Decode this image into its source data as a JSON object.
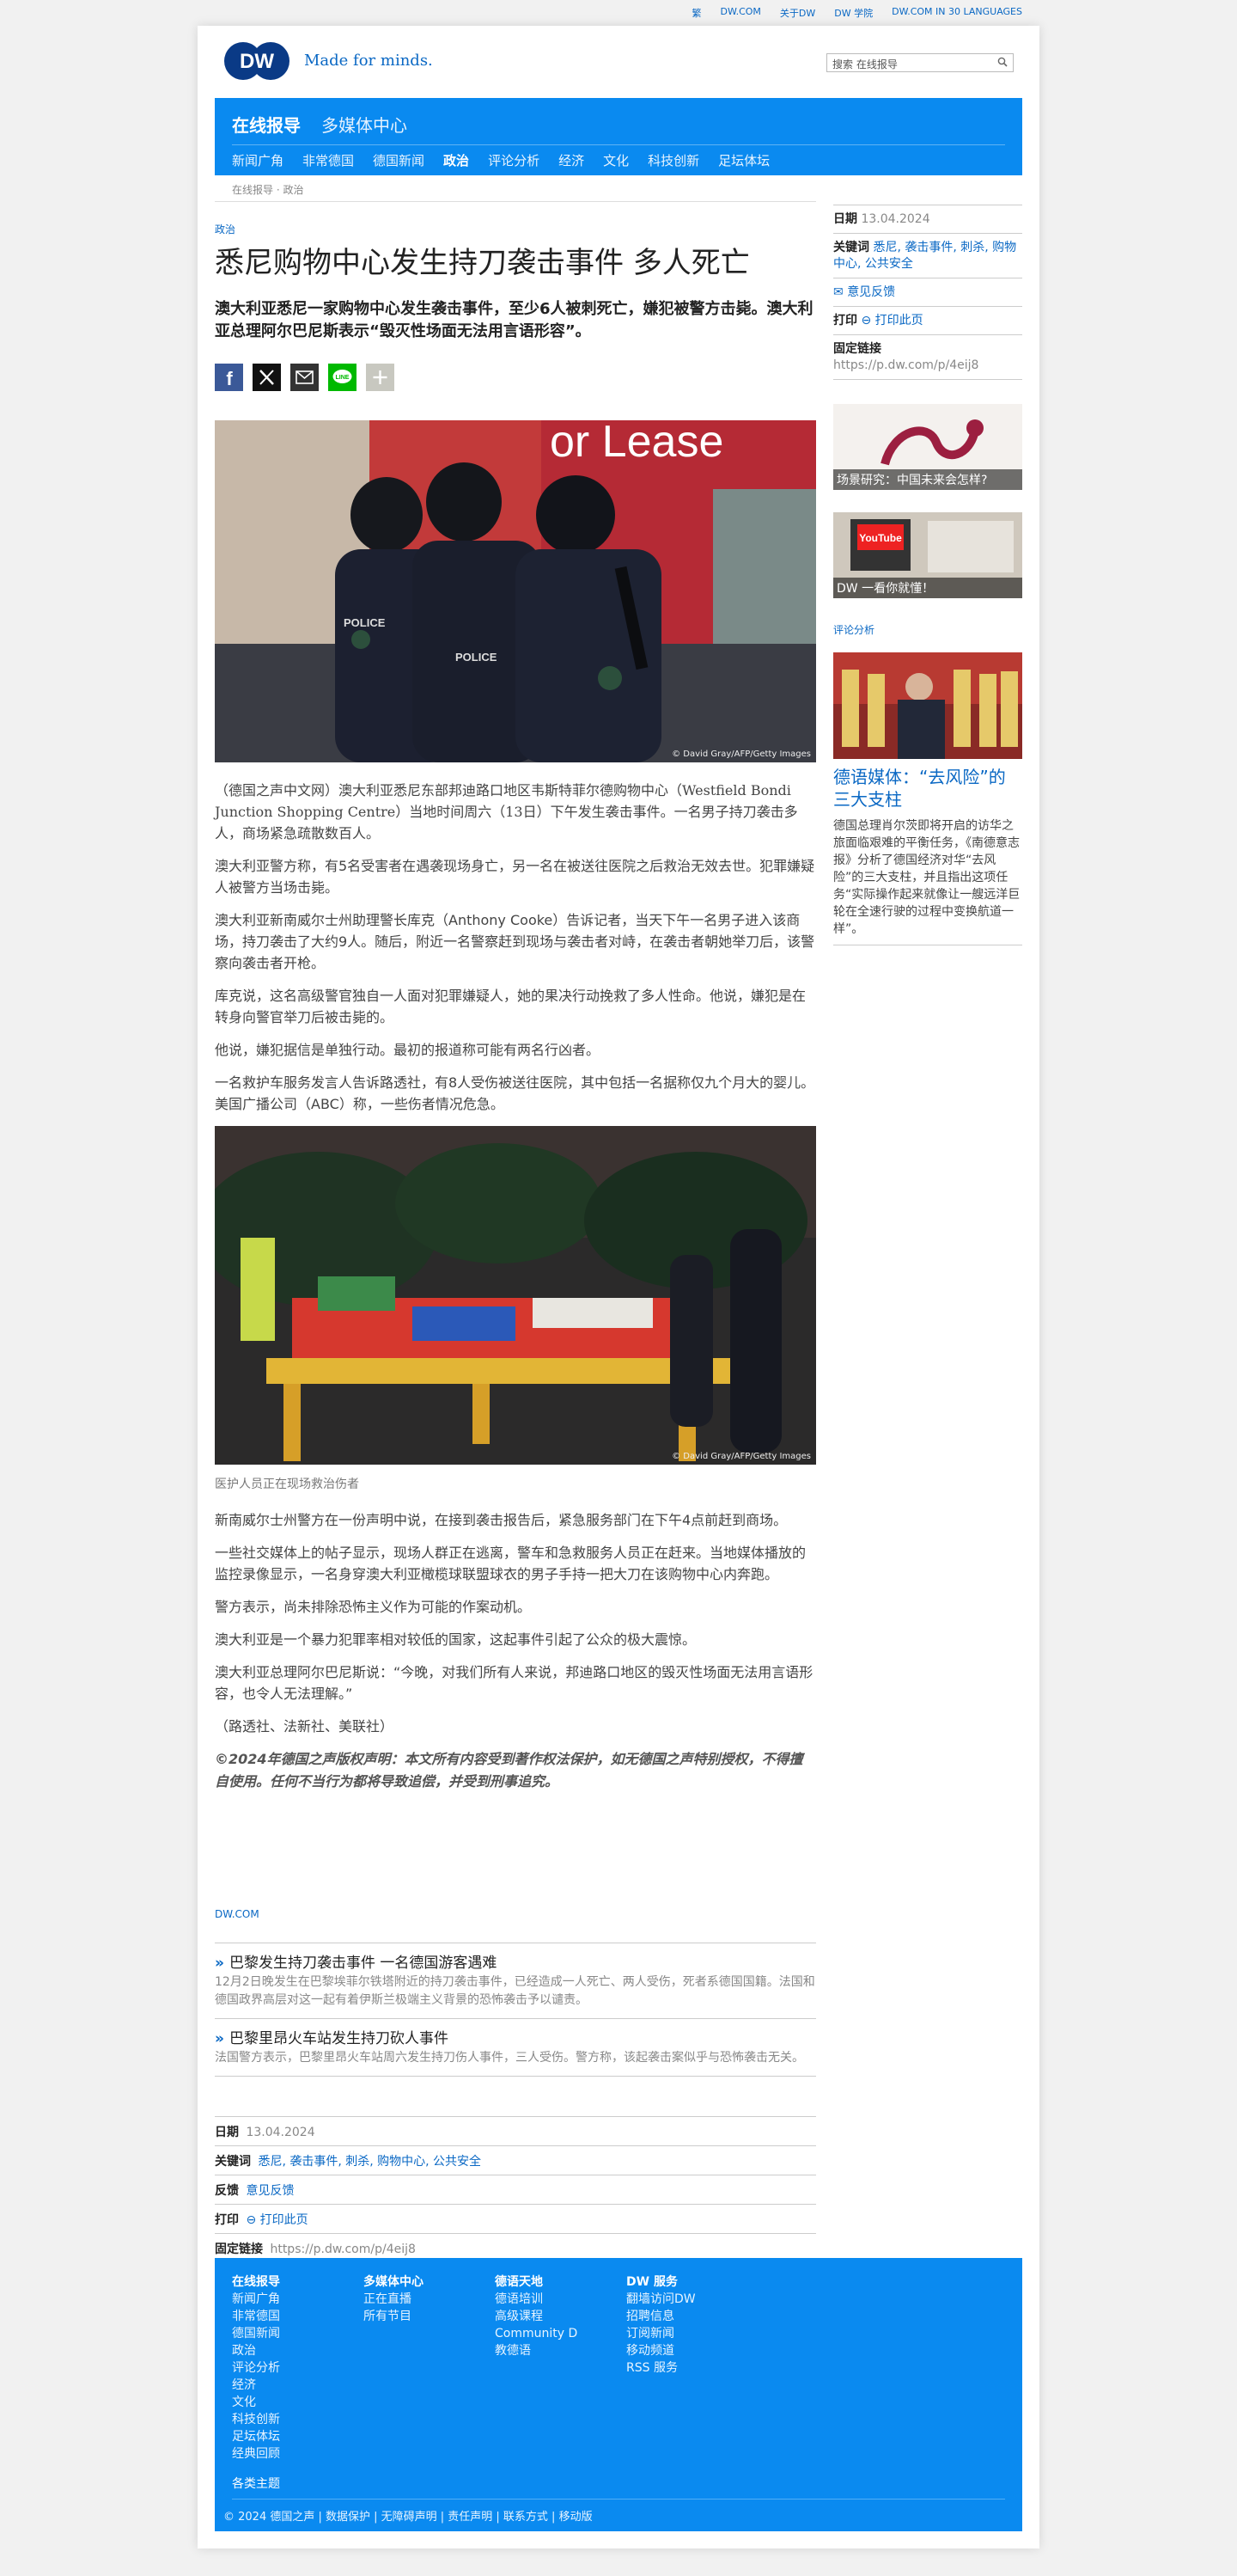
{
  "topbar": {
    "links": [
      "繁",
      "DW.COM",
      "关于DW",
      "DW 学院",
      "DW.COM IN 30 LANGUAGES"
    ]
  },
  "header": {
    "logo_text": "DW",
    "slogan": "Made for minds.",
    "search_placeholder": "搜索 在线报导"
  },
  "nav": {
    "section": "在线报导",
    "media": "多媒体中心",
    "items": [
      "新闻广角",
      "非常德国",
      "德国新闻",
      "政治",
      "评论分析",
      "经济",
      "文化",
      "科技创新",
      "足坛体坛"
    ],
    "active": "政治"
  },
  "breadcrumb": "在线报导 · 政治",
  "article": {
    "kicker": "政治",
    "headline": "悉尼购物中心发生持刀袭击事件 多人死亡",
    "lead": "澳大利亚悉尼一家购物中心发生袭击事件，至少6人被刺死亡，嫌犯被警方击毙。澳大利亚总理阿尔巴尼斯表示“毁灭性场面无法用言语形容”。",
    "share_icons": [
      "facebook-icon",
      "x-icon",
      "email-icon",
      "line-icon",
      "more-icon"
    ],
    "photo1_credit": "© David Gray/AFP/Getty Images",
    "paragraphs1": [
      "（德国之声中文网）澳大利亚悉尼东部邦迪路口地区韦斯特菲尔德购物中心（Westfield Bondi Junction Shopping Centre）当地时间周六（13日）下午发生袭击事件。一名男子持刀袭击多人，商场紧急疏散数百人。",
      "澳大利亚警方称，有5名受害者在遇袭现场身亡，另一名在被送往医院之后救治无效去世。犯罪嫌疑人被警方当场击毙。",
      "澳大利亚新南威尔士州助理警长库克（Anthony Cooke）告诉记者，当天下午一名男子进入该商场，持刀袭击了大约9人。随后，附近一名警察赶到现场与袭击者对峙，在袭击者朝她举刀后，该警察向袭击者开枪。",
      "库克说，这名高级警官独自一人面对犯罪嫌疑人，她的果决行动挽救了多人性命。他说，嫌犯是在转身向警官举刀后被击毙的。",
      "他说，嫌犯据信是单独行动。最初的报道称可能有两名行凶者。",
      "一名救护车服务发言人告诉路透社，有8人受伤被送往医院，其中包括一名据称仅九个月大的婴儿。美国广播公司（ABC）称，一些伤者情况危急。"
    ],
    "photo2_credit": "© David Gray/AFP/Getty Images",
    "photo2_caption": "医护人员正在现场救治伤者",
    "paragraphs2": [
      "新南威尔士州警方在一份声明中说，在接到袭击报告后，紧急服务部门在下午4点前赶到商场。",
      "一些社交媒体上的帖子显示，现场人群正在逃离，警车和急救服务人员正在赶来。当地媒体播放的监控录像显示，一名身穿澳大利亚橄榄球联盟球衣的男子手持一把大刀在该购物中心内奔跑。",
      "警方表示，尚未排除恐怖主义作为可能的作案动机。",
      "澳大利亚是一个暴力犯罪率相对较低的国家，这起事件引起了公众的极大震惊。",
      "澳大利亚总理阿尔巴尼斯说：“今晚，对我们所有人来说，邦迪路口地区的毁灭性场面无法用言语形容，也令人无法理解。”",
      "（路透社、法新社、美联社）"
    ],
    "copyright": "©2024年德国之声版权声明：本文所有内容受到著作权法保护，如无德国之声特别授权，不得擅自使用。任何不当行为都将导致追偿，并受到刑事追究。"
  },
  "related": {
    "label": "DW.COM",
    "items": [
      {
        "title": "巴黎发生持刀袭击事件 一名德国游客遇难",
        "desc": "12月2日晚发生在巴黎埃菲尔铁塔附近的持刀袭击事件，已经造成一人死亡、两人受伤，死者系德国国籍。法国和德国政界高层对这一起有着伊斯兰极端主义背景的恐怖袭击予以谴责。"
      },
      {
        "title": "巴黎里昂火车站发生持刀砍人事件",
        "desc": "法国警方表示，巴黎里昂火车站周六发生持刀伤人事件，三人受伤。警方称，该起袭击案似乎与恐怖袭击无关。"
      }
    ]
  },
  "meta": {
    "date_label": "日期",
    "date": "13.04.2024",
    "keywords_label": "关键词",
    "keywords": "悉尼, 袭击事件, 刺杀, 购物中心, 公共安全",
    "feedback_label": "反馈",
    "feedback": "意见反馈",
    "print_label": "打印",
    "print": "打印此页",
    "permalink_label": "固定链接",
    "permalink": "https://p.dw.com/p/4eij8"
  },
  "sidebar": {
    "feedback_link": "意见反馈",
    "promos": [
      "场景研究：中国未来会怎样?",
      "DW 一看你就懂！"
    ],
    "opinion_kicker": "评论分析",
    "opinion_title": "德语媒体：“去风险”的三大支柱",
    "opinion_desc": "德国总理肖尔茨即将开启的访华之旅面临艰难的平衡任务，《南德意志报》分析了德国经济对华“去风险”的三大支柱，并且指出这项任务“实际操作起来就像让一艘远洋巨轮在全速行驶的过程中变换航道一样”。"
  },
  "footer": {
    "cols": [
      {
        "head": "在线报导",
        "items": [
          "新闻广角",
          "非常德国",
          "德国新闻",
          "政治",
          "评论分析",
          "经济",
          "文化",
          "科技创新",
          "足坛体坛",
          "经典回顾"
        ]
      },
      {
        "head": "多媒体中心",
        "items": [
          "正在直播",
          "所有节目"
        ]
      },
      {
        "head": "德语天地",
        "items": [
          "德语培训",
          "高级课程",
          "Community D",
          "教德语"
        ]
      },
      {
        "head": "DW 服务",
        "items": [
          "翻墙访问DW",
          "招聘信息",
          "订阅新闻",
          "移动频道",
          "RSS 服务"
        ]
      }
    ],
    "topics": "各类主题",
    "bottom": "© 2024 德国之声 | 数据保护 | 无障碍声明 | 责任声明 | 联系方式 | 移动版"
  },
  "colors": {
    "brand_blue": "#0a8af0",
    "link_blue": "#0a68c4"
  }
}
